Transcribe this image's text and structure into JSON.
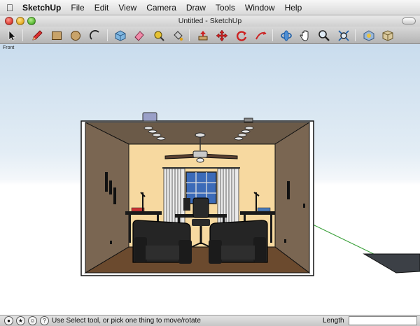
{
  "menubar": {
    "items": [
      "SketchUp",
      "File",
      "Edit",
      "View",
      "Camera",
      "Draw",
      "Tools",
      "Window",
      "Help"
    ]
  },
  "window": {
    "title": "Untitled - SketchUp"
  },
  "toolbar": {
    "tools": [
      "select-icon",
      "pencil-icon",
      "rectangle-icon",
      "circle-icon",
      "arc-icon",
      "cube-icon",
      "eraser-icon",
      "tape-measure-icon",
      "paint-bucket-icon",
      "push-pull-icon",
      "move-icon",
      "rotate-icon",
      "follow-me-icon",
      "orbit-icon",
      "pan-icon",
      "zoom-icon",
      "zoom-extents-icon",
      "3d-warehouse-icon",
      "components-icon"
    ]
  },
  "viewport": {
    "scene_label": "Front"
  },
  "statusbar": {
    "message": "Use Select tool, or pick one thing to move/rotate",
    "length_label": "Length",
    "length_value": ""
  },
  "colors": {
    "axis_green": "#3aa03a",
    "room_wall": "#6e5b46",
    "back_wall": "#f7d9a0",
    "floor": "#6b4a2e",
    "furniture": "#1c1c1c"
  }
}
